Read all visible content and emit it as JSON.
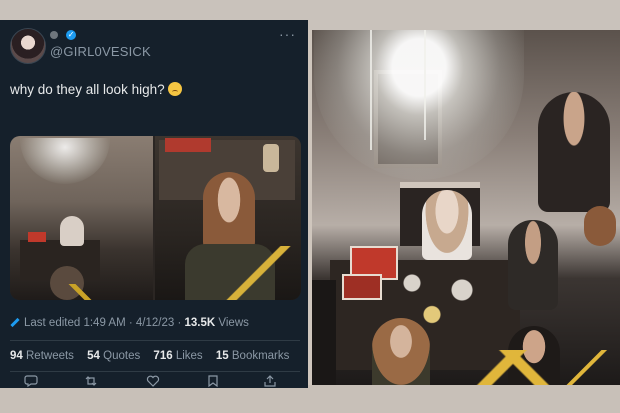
{
  "tweet": {
    "handle": "@GIRL0VESICK",
    "text": "why do they all look high?",
    "emoji": "crying-face-emoji",
    "meta": {
      "edited_label": "Last edited",
      "time": "1:49 AM",
      "date": "4/12/23",
      "views_count": "13.5K",
      "views_label": "Views"
    },
    "stats": [
      {
        "count": "94",
        "label": "Retweets"
      },
      {
        "count": "54",
        "label": "Quotes"
      },
      {
        "count": "716",
        "label": "Likes"
      },
      {
        "count": "15",
        "label": "Bookmarks"
      }
    ],
    "actions": [
      "reply-icon",
      "retweet-icon",
      "like-icon",
      "bookmark-icon",
      "share-icon"
    ]
  },
  "colors": {
    "tweet_bg": "#15202b",
    "text_primary": "#e7e9ea",
    "text_secondary": "#8b98a5",
    "accent": "#1d9bf0"
  }
}
